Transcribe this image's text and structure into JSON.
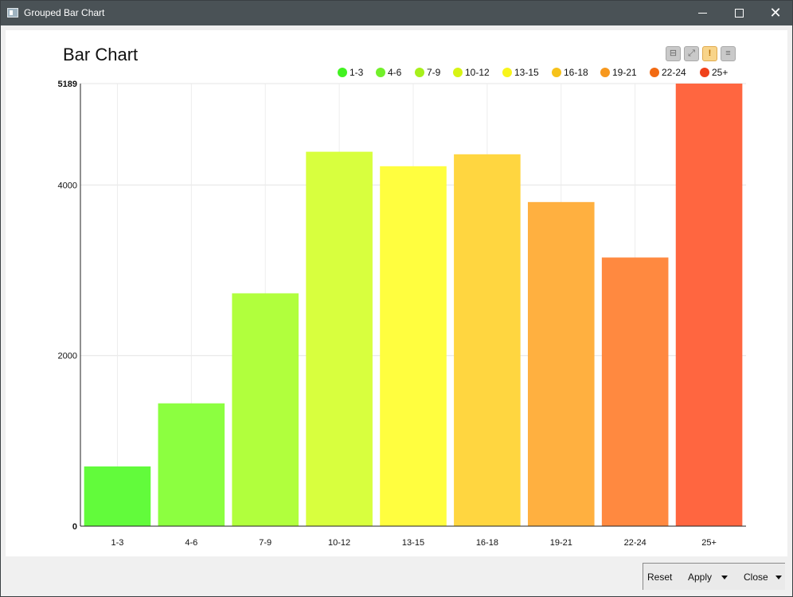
{
  "window": {
    "title": "Grouped Bar Chart"
  },
  "chart": {
    "title": "Bar Chart"
  },
  "chart_data": {
    "type": "bar",
    "title": "Bar Chart",
    "categories": [
      "1-3",
      "4-6",
      "7-9",
      "10-12",
      "13-15",
      "16-18",
      "19-21",
      "22-24",
      "25+"
    ],
    "values": [
      700,
      1440,
      2730,
      4390,
      4220,
      4360,
      3800,
      3150,
      5189
    ],
    "xlabel": "",
    "ylabel": "",
    "ylim": [
      0,
      5189
    ],
    "yticks": [
      "0",
      "2000",
      "4000",
      "5189"
    ],
    "grid": true,
    "legend_position": "top-right",
    "legend_colors": [
      "#42f221",
      "#72f02a",
      "#a7f01b",
      "#d7f414",
      "#f8f51b",
      "#f6c21a",
      "#f7981e",
      "#f26a12",
      "#f0411a"
    ],
    "bar_colors": [
      "#62fb3b",
      "#8cff40",
      "#b1ff3d",
      "#d8ff3e",
      "#fffe3f",
      "#ffd640",
      "#ffb040",
      "#ff8940",
      "#ff6640"
    ]
  },
  "footer": {
    "reset": "Reset",
    "apply": "Apply",
    "close": "Close"
  }
}
